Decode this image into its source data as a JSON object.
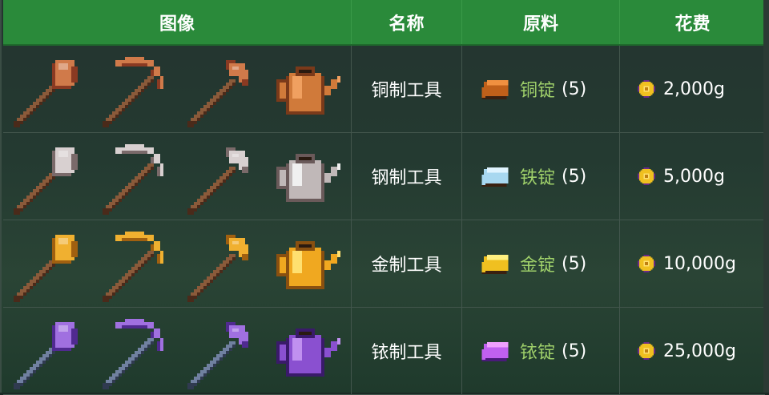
{
  "headers": {
    "image": "图像",
    "name": "名称",
    "materials": "原料",
    "cost": "花费"
  },
  "colors": {
    "header_bg": "#2a8a3a",
    "material_text": "#9fd06a"
  },
  "rows": [
    {
      "name": "铜制工具",
      "material": "铜锭",
      "quantity": "(5)",
      "cost": "2,000g",
      "palette": {
        "head": "#d07a4a",
        "head_dark": "#8a3a22",
        "handle": "#8a5a3a",
        "handle_dark": "#4a2a1a",
        "can": "#d07a3a",
        "can_dark": "#7a3a1a",
        "can_light": "#f0a060",
        "bar": "#c0601a",
        "bar_light": "#f09040"
      },
      "icons": [
        "copper-axe-icon",
        "copper-pickaxe-icon",
        "copper-hoe-icon",
        "copper-watering-can-icon",
        "copper-bar-icon"
      ]
    },
    {
      "name": "钢制工具",
      "material": "铁锭",
      "quantity": "(5)",
      "cost": "5,000g",
      "palette": {
        "head": "#d8d0d0",
        "head_dark": "#7a6a6a",
        "handle": "#8a5a3a",
        "handle_dark": "#4a2a1a",
        "can": "#c0b8b8",
        "can_dark": "#6a5a5a",
        "can_light": "#f0f0f0",
        "bar": "#a8d8f0",
        "bar_light": "#e0f4ff"
      },
      "icons": [
        "steel-axe-icon",
        "steel-pickaxe-icon",
        "steel-hoe-icon",
        "steel-watering-can-icon",
        "iron-bar-icon"
      ]
    },
    {
      "name": "金制工具",
      "material": "金锭",
      "quantity": "(5)",
      "cost": "10,000g",
      "palette": {
        "head": "#f0b030",
        "head_dark": "#a06010",
        "handle": "#8a5a3a",
        "handle_dark": "#4a2a1a",
        "can": "#f0a820",
        "can_dark": "#8a5010",
        "can_light": "#ffe070",
        "bar": "#f0c020",
        "bar_light": "#fff080"
      },
      "icons": [
        "gold-axe-icon",
        "gold-pickaxe-icon",
        "gold-hoe-icon",
        "gold-watering-can-icon",
        "gold-bar-icon"
      ]
    },
    {
      "name": "铱制工具",
      "material": "铱锭",
      "quantity": "(5)",
      "cost": "25,000g",
      "palette": {
        "head": "#a070e0",
        "head_dark": "#502a90",
        "handle": "#7080a0",
        "handle_dark": "#303a50",
        "can": "#8a50d0",
        "can_dark": "#3a1a6a",
        "can_light": "#c090f0",
        "bar": "#c060f0",
        "bar_light": "#f0a0ff"
      },
      "icons": [
        "iridium-axe-icon",
        "iridium-pickaxe-icon",
        "iridium-hoe-icon",
        "iridium-watering-can-icon",
        "iridium-bar-icon"
      ]
    }
  ],
  "coin_icon": "gold-coin-icon"
}
